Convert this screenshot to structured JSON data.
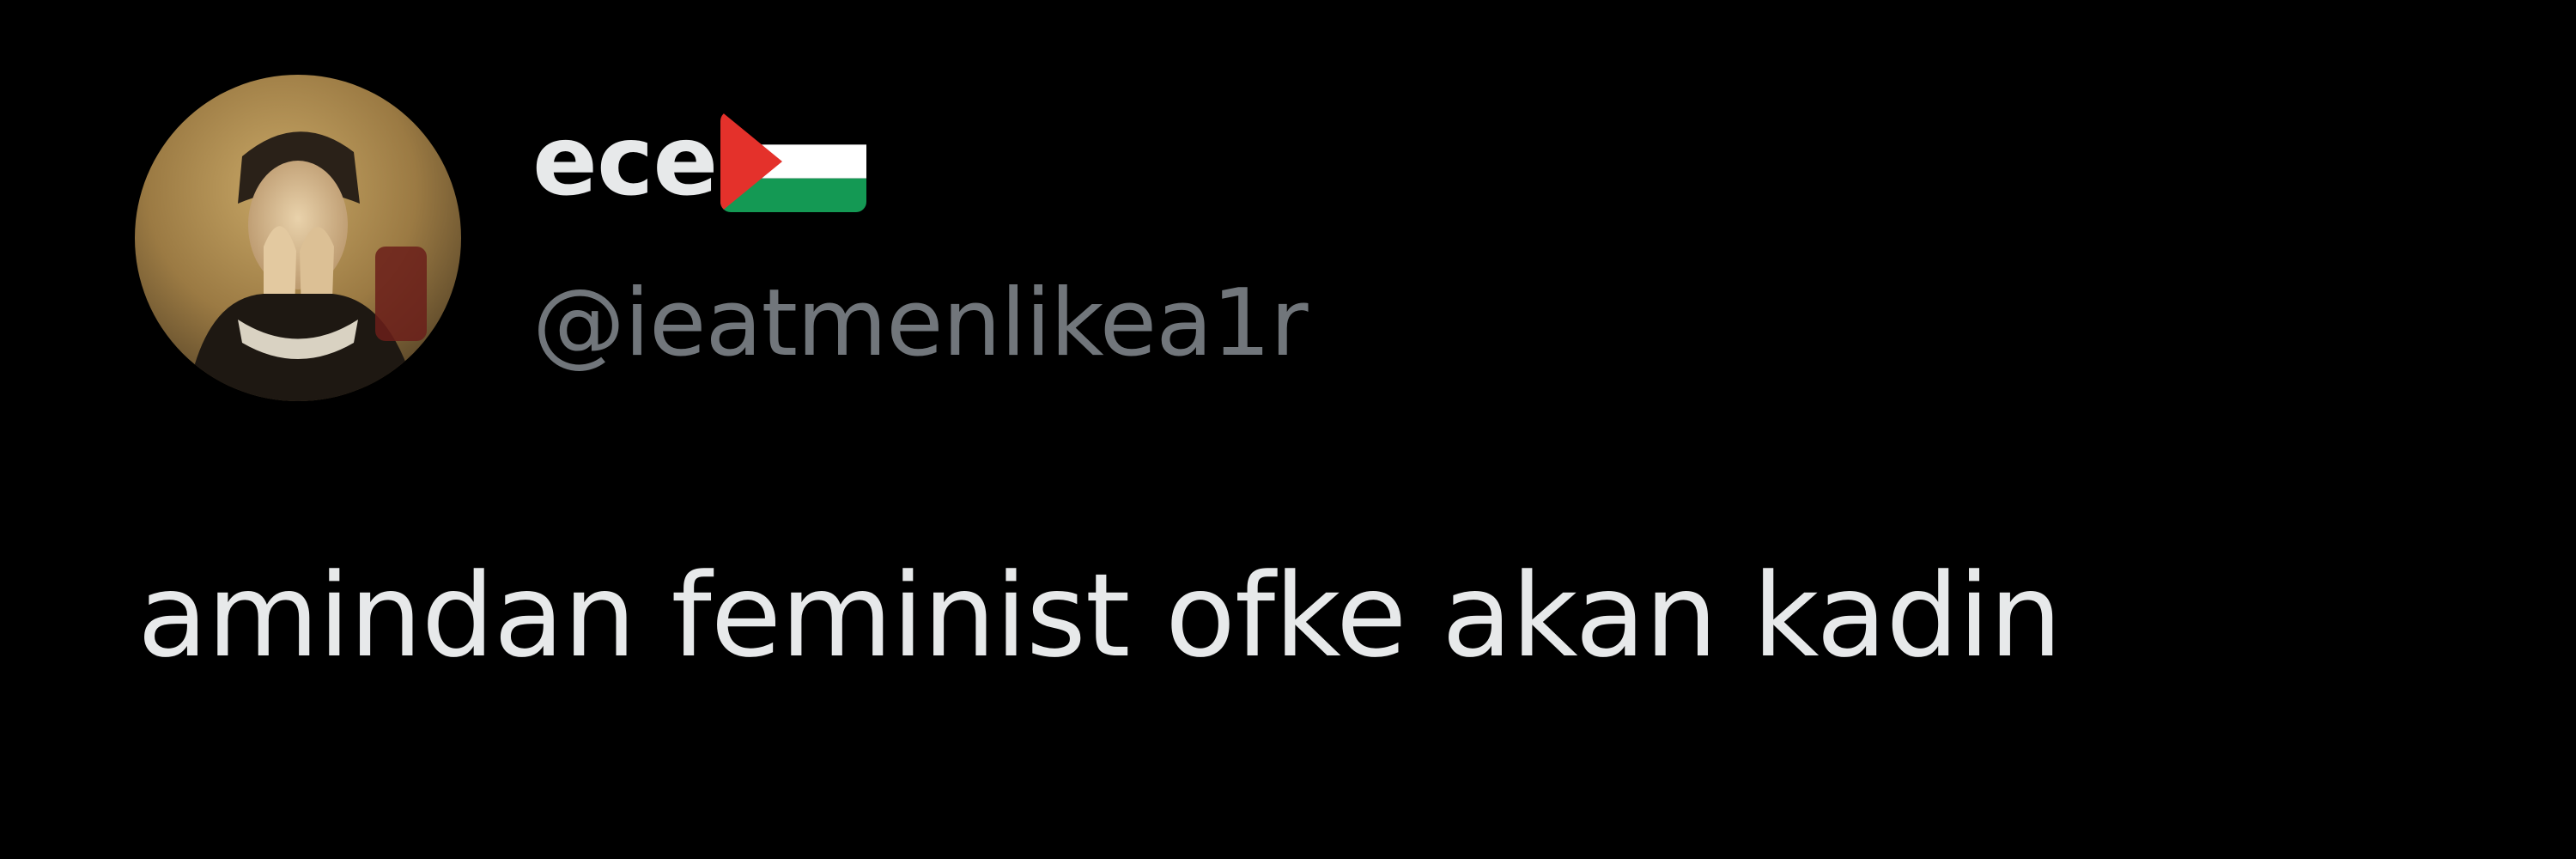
{
  "tweet": {
    "author": {
      "display_name": "ece",
      "handle": "@ieatmenlikea1r",
      "avatar_icon": "profile-photo-painting",
      "name_emoji_icon": "palestine-flag-icon"
    },
    "text": "amindan feminist ofke akan kadin"
  },
  "colors": {
    "background": "#000000",
    "primary_text": "#e7e9ea",
    "secondary_text": "#71767b",
    "flag_black": "#000000",
    "flag_white": "#ffffff",
    "flag_green": "#149954",
    "flag_red": "#e4312b"
  }
}
